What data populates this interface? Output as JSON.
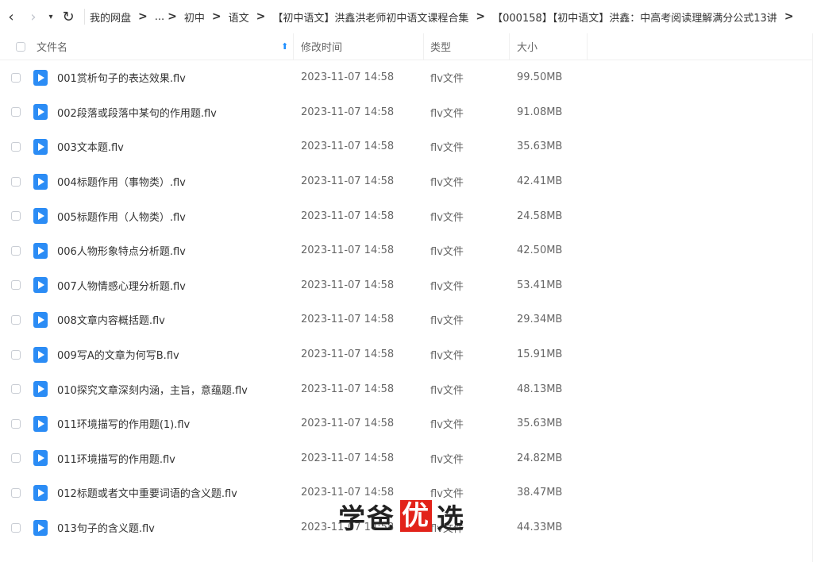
{
  "nav": {
    "back": "‹",
    "forward": "›",
    "dropdown": "▾",
    "refresh": "↻"
  },
  "breadcrumb": {
    "items": [
      "我的网盘",
      "...",
      "初中",
      "语文",
      "【初中语文】洪鑫洪老师初中语文课程合集",
      "【000158】【初中语文】洪鑫：中高考阅读理解满分公式13讲"
    ],
    "separator": ">"
  },
  "columns": {
    "name": "文件名",
    "time": "修改时间",
    "type": "类型",
    "size": "大小",
    "sort_arrow": "⬆"
  },
  "files": [
    {
      "name": "001赏析句子的表达效果.flv",
      "time": "2023-11-07 14:58",
      "type": "flv文件",
      "size": "99.50MB"
    },
    {
      "name": "002段落或段落中某句的作用题.flv",
      "time": "2023-11-07 14:58",
      "type": "flv文件",
      "size": "91.08MB"
    },
    {
      "name": "003文本题.flv",
      "time": "2023-11-07 14:58",
      "type": "flv文件",
      "size": "35.63MB"
    },
    {
      "name": "004标题作用（事物类）.flv",
      "time": "2023-11-07 14:58",
      "type": "flv文件",
      "size": "42.41MB"
    },
    {
      "name": "005标题作用（人物类）.flv",
      "time": "2023-11-07 14:58",
      "type": "flv文件",
      "size": "24.58MB"
    },
    {
      "name": "006人物形象特点分析题.flv",
      "time": "2023-11-07 14:58",
      "type": "flv文件",
      "size": "42.50MB"
    },
    {
      "name": "007人物情感心理分析题.flv",
      "time": "2023-11-07 14:58",
      "type": "flv文件",
      "size": "53.41MB"
    },
    {
      "name": "008文章内容概括题.flv",
      "time": "2023-11-07 14:58",
      "type": "flv文件",
      "size": "29.34MB"
    },
    {
      "name": "009写A的文章为何写B.flv",
      "time": "2023-11-07 14:58",
      "type": "flv文件",
      "size": "15.91MB"
    },
    {
      "name": "010探究文章深刻内涵，主旨，意蕴题.flv",
      "time": "2023-11-07 14:58",
      "type": "flv文件",
      "size": "48.13MB"
    },
    {
      "name": "011环境描写的作用题(1).flv",
      "time": "2023-11-07 14:58",
      "type": "flv文件",
      "size": "35.63MB"
    },
    {
      "name": "011环境描写的作用题.flv",
      "time": "2023-11-07 14:58",
      "type": "flv文件",
      "size": "24.82MB"
    },
    {
      "name": "012标题或者文中重要词语的含义题.flv",
      "time": "2023-11-07 14:58",
      "type": "flv文件",
      "size": "38.47MB"
    },
    {
      "name": "013句子的含义题.flv",
      "time": "2023-11-07 14:58",
      "type": "flv文件",
      "size": "44.33MB"
    }
  ],
  "watermark": {
    "part1": "学爸",
    "boxed": "优",
    "part2": "选",
    "box_color": "#e2231a"
  },
  "colors": {
    "accent": "#1f8fff",
    "file_icon": "#2b8cf5"
  }
}
